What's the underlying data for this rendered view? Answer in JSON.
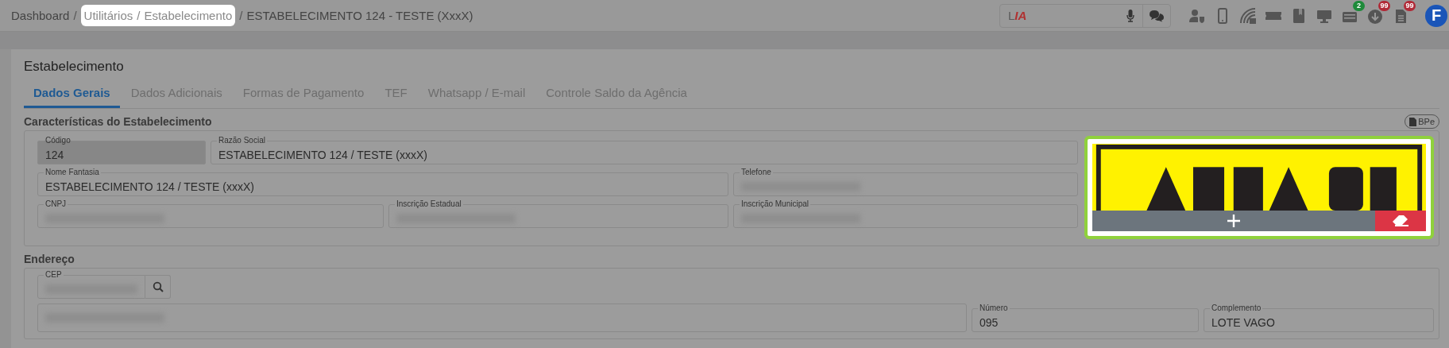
{
  "breadcrumb": {
    "separator": "/",
    "items": [
      {
        "label": "Dashboard",
        "highlighted": false
      },
      {
        "label": "Utilitários",
        "highlighted": true
      },
      {
        "label": "Estabelecimento",
        "highlighted": true
      },
      {
        "label": "ESTABELECIMENTO 124 - TESTE (XxxX)",
        "highlighted": false
      }
    ]
  },
  "assistant_field": {
    "placeholder": "L**IA**"
  },
  "toolbar_icons": [
    {
      "kind": "user-shield"
    },
    {
      "kind": "phone"
    },
    {
      "kind": "feed"
    },
    {
      "kind": "ticket"
    },
    {
      "kind": "book"
    },
    {
      "kind": "monitor"
    },
    {
      "kind": "keyboard",
      "badge": "2",
      "color": "#1e8a3a"
    },
    {
      "kind": "download",
      "badge": "99",
      "color": "#b02a37"
    },
    {
      "kind": "document",
      "badge": "99",
      "color": "#b02a37"
    }
  ],
  "avatar": {
    "initial": "F"
  },
  "page_title": "Estabelecimento",
  "tabs": [
    {
      "label": "Dados Gerais",
      "selected": true
    },
    {
      "label": "Dados Adicionais",
      "selected": false
    },
    {
      "label": "Formas de Pagamento",
      "selected": false
    },
    {
      "label": "TEF",
      "selected": false
    },
    {
      "label": "Whatsapp / E-mail",
      "selected": false
    },
    {
      "label": "Controle Saldo da Agência",
      "selected": false
    }
  ],
  "characteristics": {
    "title": "Características do Estabelecimento",
    "bpe_button": "BPe",
    "fields": [
      {
        "label": "Código",
        "value": "124",
        "disabled": true,
        "redacted": false
      },
      {
        "label": "Razão Social",
        "value": "ESTABELECIMENTO 124 / TESTE (xxxX)",
        "disabled": false,
        "redacted": false
      },
      {
        "label": "Nome Fantasia",
        "value": "ESTABELECIMENTO 124 / TESTE (xxxX)",
        "disabled": false,
        "redacted": false
      },
      {
        "label": "Telefone",
        "disabled": false,
        "redacted": true
      },
      {
        "label": "CNPJ",
        "disabled": false,
        "redacted": true
      },
      {
        "label": "Inscrição Estadual",
        "disabled": false,
        "redacted": true
      },
      {
        "label": "Inscrição Municipal",
        "disabled": false,
        "redacted": true
      }
    ],
    "image_panel": {
      "kind": "picture",
      "highlighted": true
    }
  },
  "address": {
    "title": "Endereço",
    "cep": {
      "label": "CEP",
      "redacted": true
    },
    "fields": [
      {
        "disabled": false,
        "redacted": true
      },
      {
        "label": "Número",
        "value": "095",
        "disabled": false,
        "redacted": false
      },
      {
        "label": "Complemento",
        "value": "LOTE VAGO",
        "disabled": false,
        "redacted": false
      }
    ]
  }
}
